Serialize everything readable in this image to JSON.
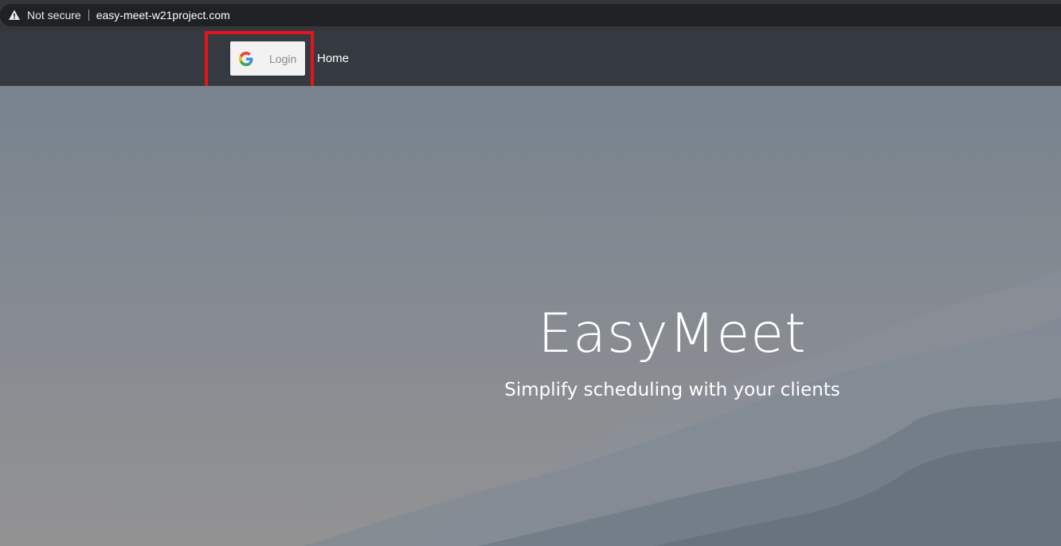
{
  "browser": {
    "security_label": "Not secure",
    "url": "easy-meet-w21project.com",
    "security_icon": "warning-triangle-icon"
  },
  "navbar": {
    "login_label": "Login",
    "login_icon": "google-g-icon",
    "home_label": "Home",
    "highlight_color": "#e3141c"
  },
  "hero": {
    "title": "EasyMeet",
    "subtitle": "Simplify scheduling with your clients"
  }
}
